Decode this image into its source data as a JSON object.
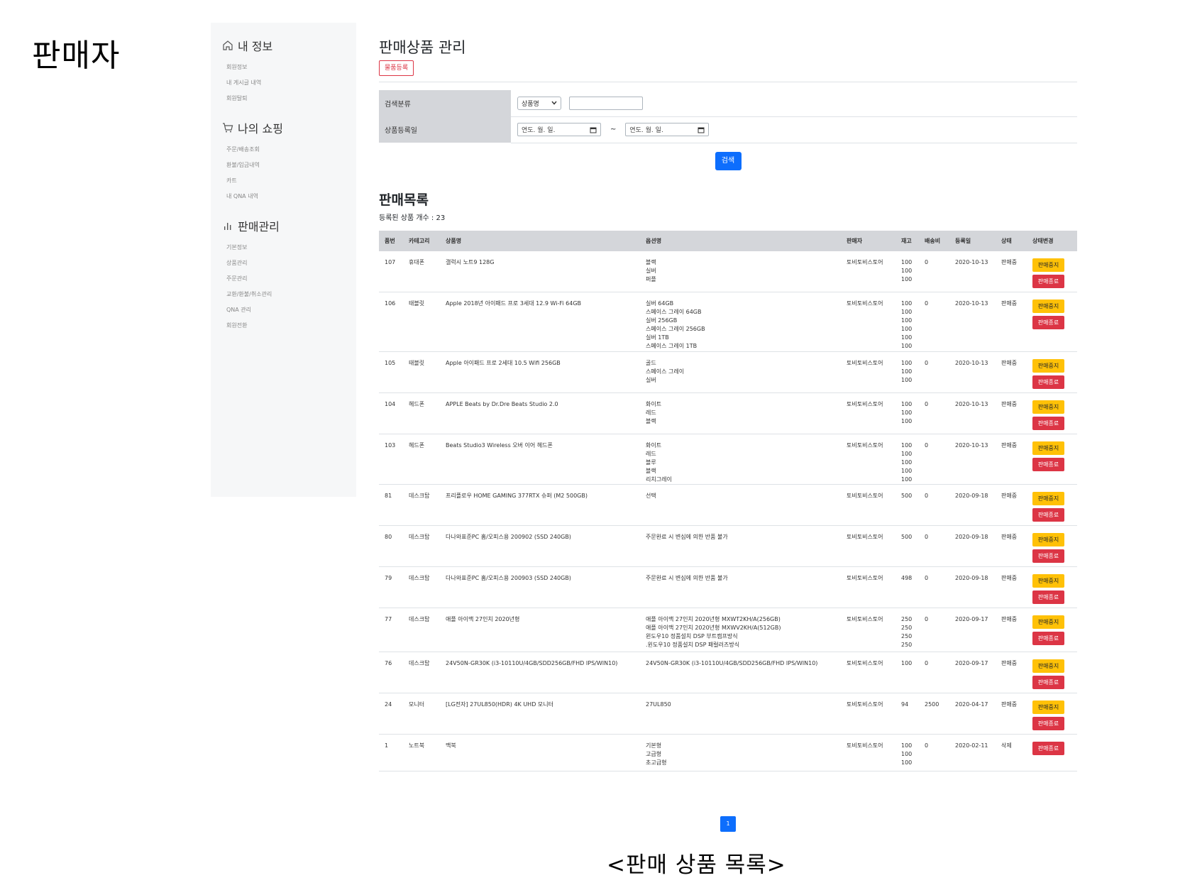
{
  "page": {
    "role_title": "판매자",
    "caption": "<판매 상품 목록>"
  },
  "sidebar": {
    "groups": [
      {
        "heading": "내 정보",
        "icon": "home-icon",
        "items": [
          "회원정보",
          "내 게시글 내역",
          "회원탈퇴"
        ]
      },
      {
        "heading": "나의 쇼핑",
        "icon": "cart-icon",
        "items": [
          "주문/배송조회",
          "환불/입금내역",
          "카트",
          "내 QNA 내역"
        ]
      },
      {
        "heading": "판매관리",
        "icon": "bar-chart-icon",
        "items": [
          "기본정보",
          "상품관리",
          "주문관리",
          "교환/환불/취소관리",
          "QNA 관리",
          "회원전환"
        ]
      }
    ]
  },
  "main": {
    "title": "판매상품 관리",
    "register_button": "물품등록",
    "search": {
      "category_label": "검색분류",
      "category_selected": "상품명",
      "date_label": "상품등록일",
      "date_placeholder": "연도. 월. 일.",
      "tilde": "~",
      "search_button": "검색"
    },
    "list_title": "판매목록",
    "count_text": "등록된 상품 개수 : 23",
    "columns": [
      "품번",
      "카테고리",
      "상품명",
      "옵션명",
      "판매자",
      "재고",
      "배송비",
      "등록일",
      "상태",
      "상태변경"
    ],
    "stop_label": "판매중지",
    "end_label": "판매종료",
    "rows": [
      {
        "id": "107",
        "category": "휴대폰",
        "name": "갤럭시 노트9 128G",
        "options": [
          "블랙",
          "실버",
          "퍼플"
        ],
        "seller": "토비토비스토어",
        "stock": [
          "100",
          "100",
          "100"
        ],
        "shipping": "0",
        "date": "2020-10-13",
        "status": "판매중",
        "can_stop": true
      },
      {
        "id": "106",
        "category": "태블릿",
        "name": "Apple 2018년 아이패드 프로 3세대 12.9 Wi-Fi 64GB",
        "options": [
          "실버 64GB",
          "스페이스 그레이 64GB",
          "실버 256GB",
          "스페이스 그레이 256GB",
          "실버 1TB",
          "스페이스 그레이 1TB"
        ],
        "seller": "토비토비스토어",
        "stock": [
          "100",
          "100",
          "100",
          "100",
          "100",
          "100"
        ],
        "shipping": "0",
        "date": "2020-10-13",
        "status": "판매중",
        "can_stop": true
      },
      {
        "id": "105",
        "category": "태블릿",
        "name": "Apple 아이패드 프로 2세대 10.5 Wifi 256GB",
        "options": [
          "골드",
          "스페이스 그레이",
          "실버"
        ],
        "seller": "토비토비스토어",
        "stock": [
          "100",
          "100",
          "100"
        ],
        "shipping": "0",
        "date": "2020-10-13",
        "status": "판매중",
        "can_stop": true
      },
      {
        "id": "104",
        "category": "헤드폰",
        "name": "APPLE Beats by Dr.Dre Beats Studio 2.0",
        "options": [
          "화이트",
          "레드",
          "블랙"
        ],
        "seller": "토비토비스토어",
        "stock": [
          "100",
          "100",
          "100"
        ],
        "shipping": "0",
        "date": "2020-10-13",
        "status": "판매중",
        "can_stop": true
      },
      {
        "id": "103",
        "category": "헤드폰",
        "name": "Beats Studio3 Wireless 오버 이어 헤드폰",
        "options": [
          "화이트",
          "레드",
          "블루",
          "블랙",
          "리치그레이"
        ],
        "seller": "토비토비스토어",
        "stock": [
          "100",
          "100",
          "100",
          "100",
          "100"
        ],
        "shipping": "0",
        "date": "2020-10-13",
        "status": "판매중",
        "can_stop": true
      },
      {
        "id": "81",
        "category": "데스크탑",
        "name": "프리플로우 HOME GAMING 377RTX 슈퍼 (M2 500GB)",
        "options": [
          "선택"
        ],
        "seller": "토비토비스토어",
        "stock": [
          "500"
        ],
        "shipping": "0",
        "date": "2020-09-18",
        "status": "판매중",
        "can_stop": true
      },
      {
        "id": "80",
        "category": "데스크탑",
        "name": "다나와표준PC 홈/오피스용 200902 (SSD 240GB)",
        "options": [
          "주문완료 시 변심에 의한 반품 불가"
        ],
        "seller": "토비토비스토어",
        "stock": [
          "500"
        ],
        "shipping": "0",
        "date": "2020-09-18",
        "status": "판매중",
        "can_stop": true
      },
      {
        "id": "79",
        "category": "데스크탑",
        "name": "다나와표준PC 홈/오피스용 200903 (SSD 240GB)",
        "options": [
          "주문완료 시 변심에 의한 반품 불가"
        ],
        "seller": "토비토비스토어",
        "stock": [
          "498"
        ],
        "shipping": "0",
        "date": "2020-09-18",
        "status": "판매중",
        "can_stop": true
      },
      {
        "id": "77",
        "category": "데스크탑",
        "name": "애플 아이맥 27인치 2020년형",
        "options": [
          "애플 아이맥 27인치 2020년형 MXWT2KH/A(256GB)",
          "애플 아이맥 27인치 2020년형 MXWV2KH/A(512GB)",
          "윈도우10 정품설치 DSP 부트캠프방식",
          ".윈도우10 정품설치 DSP 패럴러즈방식"
        ],
        "seller": "토비토비스토어",
        "stock": [
          "250",
          "250",
          "250",
          "250"
        ],
        "shipping": "0",
        "date": "2020-09-17",
        "status": "판매중",
        "can_stop": true
      },
      {
        "id": "76",
        "category": "데스크탑",
        "name": "24V50N-GR30K (i3-10110U/4GB/SDD256GB/FHD IPS/WIN10)",
        "options": [
          "24V50N-GR30K (i3-10110U/4GB/SDD256GB/FHD IPS/WIN10)"
        ],
        "seller": "토비토비스토어",
        "stock": [
          "100"
        ],
        "shipping": "0",
        "date": "2020-09-17",
        "status": "판매중",
        "can_stop": true
      },
      {
        "id": "24",
        "category": "모니터",
        "name": "[LG전자] 27UL850(HDR) 4K UHD 모니터",
        "options": [
          "27UL850"
        ],
        "seller": "토비토비스토어",
        "stock": [
          "94"
        ],
        "shipping": "2500",
        "date": "2020-04-17",
        "status": "판매중",
        "can_stop": true
      },
      {
        "id": "1",
        "category": "노트북",
        "name": "맥북",
        "options": [
          "기본형",
          "고급형",
          "초고급형"
        ],
        "seller": "토비토비스토어",
        "stock": [
          "100",
          "100",
          "100"
        ],
        "shipping": "0",
        "date": "2020-02-11",
        "status": "삭제",
        "can_stop": false
      }
    ],
    "pagination": {
      "current": "1"
    }
  },
  "colors": {
    "primary": "#0d6efd",
    "danger": "#dc3545",
    "warning": "#ffc107",
    "sidebar_bg": "#f6f7f8",
    "header_bg": "#d4d6da"
  }
}
